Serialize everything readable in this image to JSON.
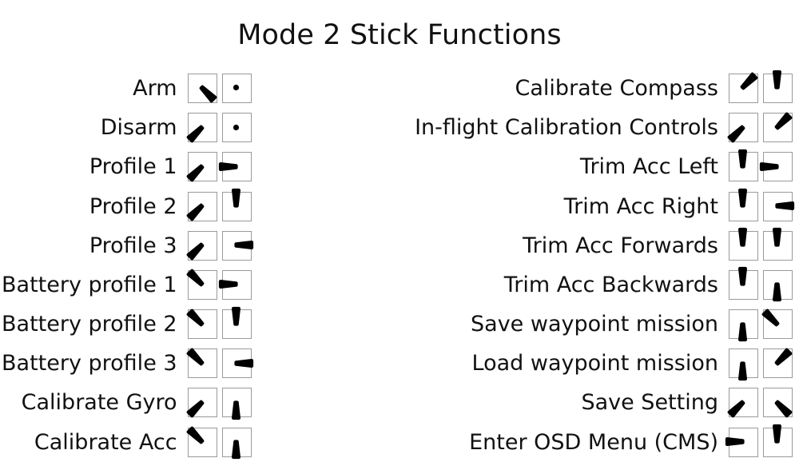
{
  "title": "Mode 2 Stick Functions",
  "legend": {
    "center_icon": "stick-center-dot-icon",
    "box_icon": "stick-gimbal-box-icon",
    "directions": [
      "center",
      "up",
      "down",
      "left",
      "right",
      "up-left",
      "up-right",
      "down-left",
      "down-right"
    ]
  },
  "columns": [
    {
      "name": "left-column",
      "rows": [
        {
          "label": "Arm",
          "left_stick": "down-right",
          "right_stick": "center"
        },
        {
          "label": "Disarm",
          "left_stick": "down-left",
          "right_stick": "center"
        },
        {
          "label": "Profile 1",
          "left_stick": "down-left",
          "right_stick": "left"
        },
        {
          "label": "Profile 2",
          "left_stick": "down-left",
          "right_stick": "up"
        },
        {
          "label": "Profile 3",
          "left_stick": "down-left",
          "right_stick": "right"
        },
        {
          "label": "Battery profile 1",
          "left_stick": "up-left",
          "right_stick": "left"
        },
        {
          "label": "Battery profile 2",
          "left_stick": "up-left",
          "right_stick": "up"
        },
        {
          "label": "Battery profile 3",
          "left_stick": "up-left",
          "right_stick": "right"
        },
        {
          "label": "Calibrate Gyro",
          "left_stick": "down-left",
          "right_stick": "down"
        },
        {
          "label": "Calibrate Acc",
          "left_stick": "up-left",
          "right_stick": "down"
        }
      ]
    },
    {
      "name": "right-column",
      "rows": [
        {
          "label": "Calibrate Compass",
          "left_stick": "up-right",
          "right_stick": "up"
        },
        {
          "label": "In-flight Calibration Controls",
          "left_stick": "down-left",
          "right_stick": "up-right"
        },
        {
          "label": "Trim Acc Left",
          "left_stick": "up",
          "right_stick": "left"
        },
        {
          "label": "Trim Acc Right",
          "left_stick": "up",
          "right_stick": "right"
        },
        {
          "label": "Trim Acc Forwards",
          "left_stick": "up",
          "right_stick": "up"
        },
        {
          "label": "Trim Acc Backwards",
          "left_stick": "up",
          "right_stick": "down"
        },
        {
          "label": "Save waypoint mission",
          "left_stick": "down",
          "right_stick": "up-left"
        },
        {
          "label": "Load waypoint mission",
          "left_stick": "down",
          "right_stick": "up-right"
        },
        {
          "label": "Save Setting",
          "left_stick": "down-left",
          "right_stick": "down-right"
        },
        {
          "label": "Enter OSD Menu (CMS)",
          "left_stick": "left",
          "right_stick": "up"
        }
      ]
    }
  ],
  "colors": {
    "background": "#ffffff",
    "text": "#111111",
    "stick": "#000000",
    "box_border": "#9a9a9a"
  }
}
